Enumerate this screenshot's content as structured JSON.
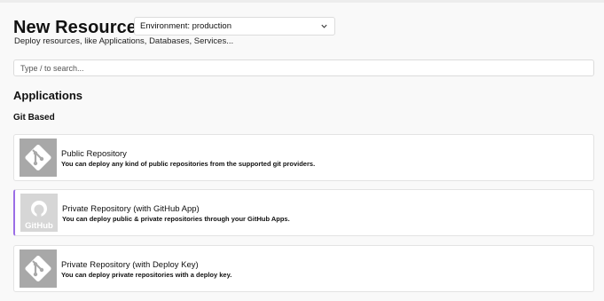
{
  "page": {
    "title": "New Resource",
    "subtitle": "Deploy resources, like Applications, Databases, Services..."
  },
  "environment": {
    "label": "Environment: production"
  },
  "search": {
    "placeholder": "Type / to search..."
  },
  "section": {
    "title": "Applications"
  },
  "group": {
    "title": "Git Based"
  },
  "cards": [
    {
      "name": "Public Repository",
      "description": "You can deploy any kind of public repositories from the supported git providers.",
      "icon": "git-icon"
    },
    {
      "name": "Private Repository (with GitHub App)",
      "description": "You can deploy public & private repositories through your GitHub Apps.",
      "icon": "github-icon",
      "logo_text": "GitHub"
    },
    {
      "name": "Private Repository (with Deploy Key)",
      "description": "You can deploy private repositories with a deploy key.",
      "icon": "git-icon"
    }
  ],
  "colors": {
    "accent": "#9b6ee6",
    "logo_bg": "#a8a8a8"
  }
}
